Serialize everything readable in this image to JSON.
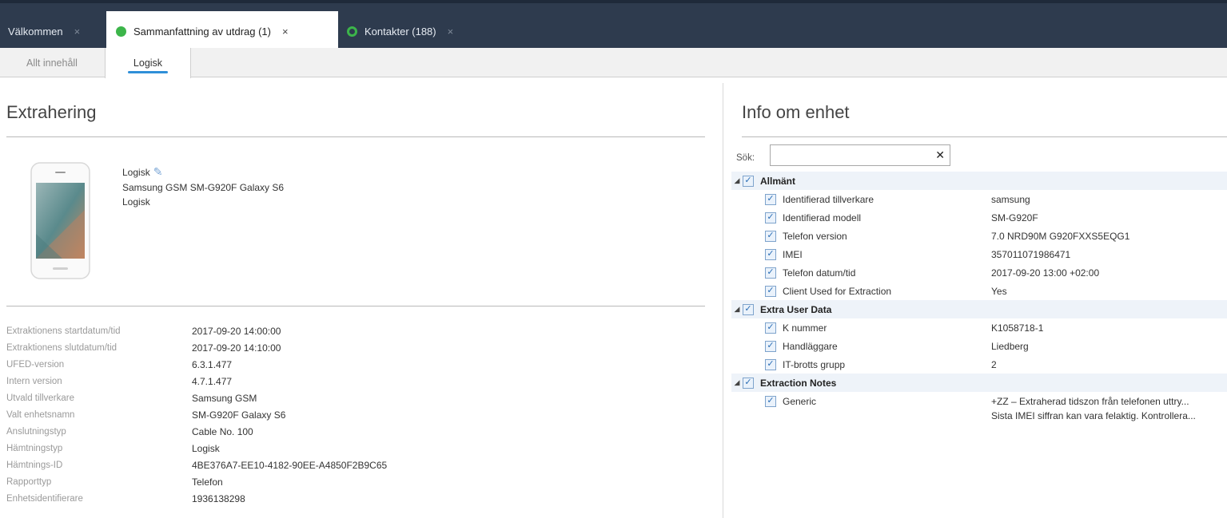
{
  "tabs": [
    {
      "label": "Välkommen",
      "active": false,
      "dot": "none"
    },
    {
      "label": "Sammanfattning av utdrag (1)",
      "active": true,
      "dot": "filled"
    },
    {
      "label": "Kontakter (188)",
      "active": false,
      "dot": "ring"
    }
  ],
  "tab_close_glyph": "×",
  "subtabs": [
    {
      "label": "Allt innehåll",
      "active": false
    },
    {
      "label": "Logisk",
      "active": true
    }
  ],
  "left": {
    "title": "Extrahering",
    "device_icon": "phone-icon",
    "device_lines": [
      "Logisk",
      "Samsung GSM SM-G920F Galaxy S6",
      "Logisk"
    ],
    "properties": [
      {
        "label": "Extraktionens startdatum/tid",
        "value": "2017-09-20 14:00:00"
      },
      {
        "label": "Extraktionens slutdatum/tid",
        "value": "2017-09-20 14:10:00"
      },
      {
        "label": "UFED-version",
        "value": "6.3.1.477"
      },
      {
        "label": "Intern version",
        "value": "4.7.1.477"
      },
      {
        "label": "Utvald tillverkare",
        "value": "Samsung GSM"
      },
      {
        "label": "Valt enhetsnamn",
        "value": "SM-G920F Galaxy S6"
      },
      {
        "label": "Anslutningstyp",
        "value": "Cable No. 100"
      },
      {
        "label": "Hämtningstyp",
        "value": "Logisk"
      },
      {
        "label": "Hämtnings-ID",
        "value": "4BE376A7-EE10-4182-90EE-A4850F2B9C65"
      },
      {
        "label": "Rapporttyp",
        "value": "Telefon"
      },
      {
        "label": "Enhetsidentifierare",
        "value": "1936138298"
      }
    ]
  },
  "right": {
    "title": "Info om enhet",
    "search": {
      "label": "Sök:",
      "value": "",
      "placeholder": "",
      "clear_glyph": "✕"
    },
    "groups": [
      {
        "name": "Allmänt",
        "items": [
          {
            "label": "Identifierad tillverkare",
            "value": "samsung"
          },
          {
            "label": "Identifierad modell",
            "value": "SM-G920F"
          },
          {
            "label": "Telefon version",
            "value": "7.0 NRD90M G920FXXS5EQG1"
          },
          {
            "label": "IMEI",
            "value": "357011071986471"
          },
          {
            "label": "Telefon datum/tid",
            "value": "2017-09-20 13:00 +02:00"
          },
          {
            "label": "Client Used for Extraction",
            "value": "Yes"
          }
        ]
      },
      {
        "name": "Extra User Data",
        "items": [
          {
            "label": "K nummer",
            "value": "K1058718-1"
          },
          {
            "label": "Handläggare",
            "value": "Liedberg"
          },
          {
            "label": "IT-brotts grupp",
            "value": "2"
          }
        ]
      },
      {
        "name": "Extraction Notes",
        "items": [
          {
            "label": "Generic",
            "value": "+ZZ – Extraherad tidszon från telefonen uttry...",
            "value2": "Sista IMEI siffran kan vara felaktig. Kontrollera..."
          }
        ]
      }
    ]
  },
  "colors": {
    "tabbar": "#2e3b4e",
    "accent": "#2f8fd8",
    "status_green": "#3cb54a"
  }
}
